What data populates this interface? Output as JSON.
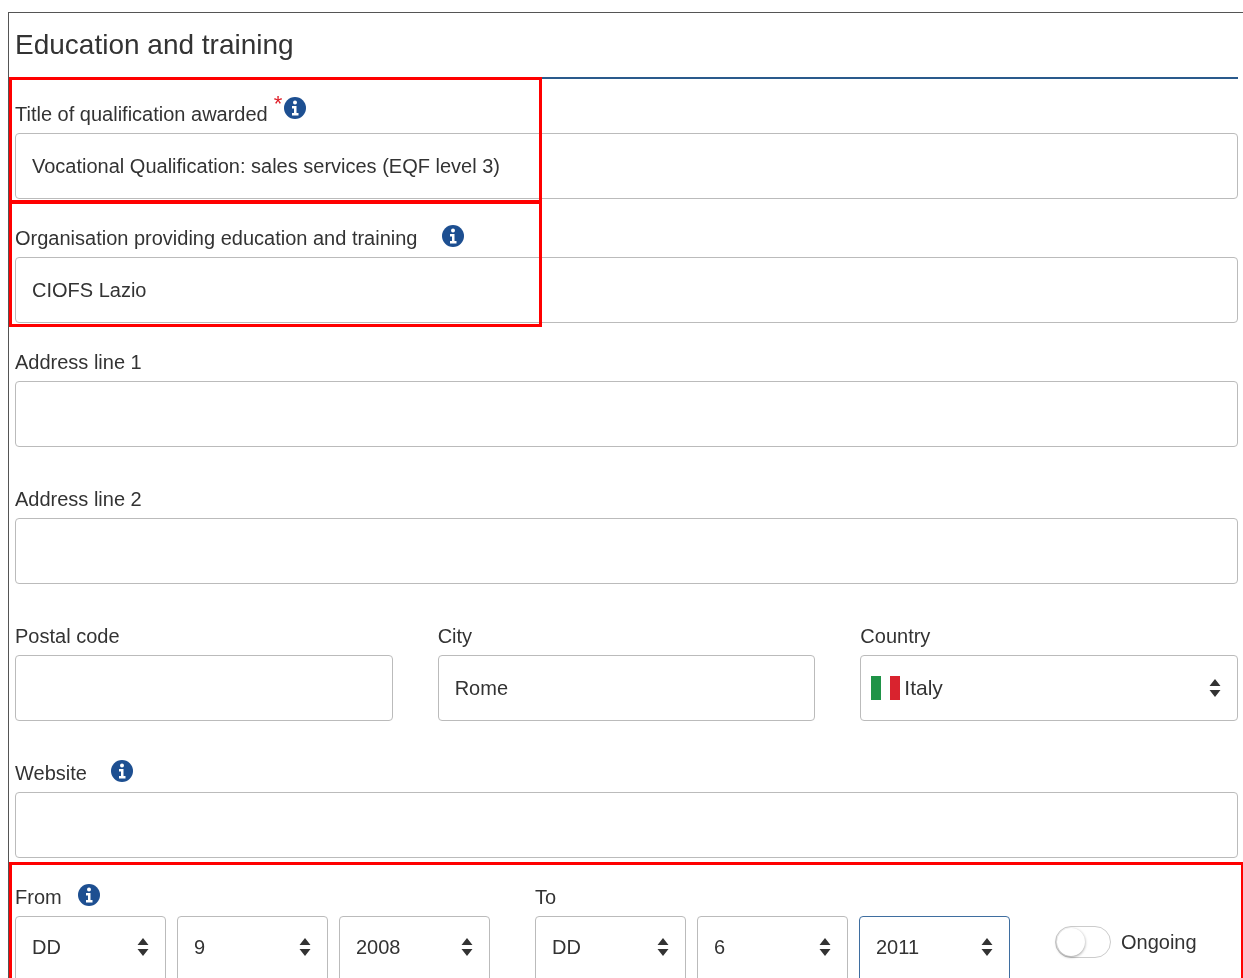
{
  "section": {
    "title": "Education and training"
  },
  "rows": [
    {
      "highlighted": true,
      "fields": [
        {
          "kind": "text",
          "label": "Title of qualification awarded",
          "required_mark": "*",
          "info": true,
          "value": "Vocational Qualification: sales services (EQF level 3)"
        }
      ]
    },
    {
      "highlighted": true,
      "fields": [
        {
          "kind": "text",
          "label": "Organisation providing education and training",
          "info": true,
          "value": "CIOFS Lazio"
        }
      ]
    },
    {
      "fields": [
        {
          "kind": "text",
          "label": "Address line 1"
        }
      ]
    },
    {
      "fields": [
        {
          "kind": "text",
          "label": "Address line 2"
        }
      ]
    },
    {
      "fields": [
        {
          "kind": "text",
          "label": "Postal code"
        },
        {
          "kind": "text",
          "label": "City",
          "value": "Rome"
        },
        {
          "kind": "select",
          "label": "Country",
          "value": "Italy",
          "flag": true
        }
      ]
    },
    {
      "fields": [
        {
          "kind": "text",
          "label": "Website",
          "info": true
        }
      ]
    }
  ],
  "dates": {
    "highlighted": true,
    "from": {
      "label": "From",
      "info": true,
      "selects": [
        {
          "value": "DD",
          "focused": false
        },
        {
          "value": "9",
          "focused": false
        },
        {
          "value": "2008",
          "focused": false
        }
      ]
    },
    "to": {
      "label": "To",
      "selects": [
        {
          "value": "DD",
          "focused": false
        },
        {
          "value": "6",
          "focused": false
        },
        {
          "value": "2011",
          "focused": true
        }
      ]
    },
    "ongoing": {
      "label": "Ongoing",
      "on": false
    }
  }
}
